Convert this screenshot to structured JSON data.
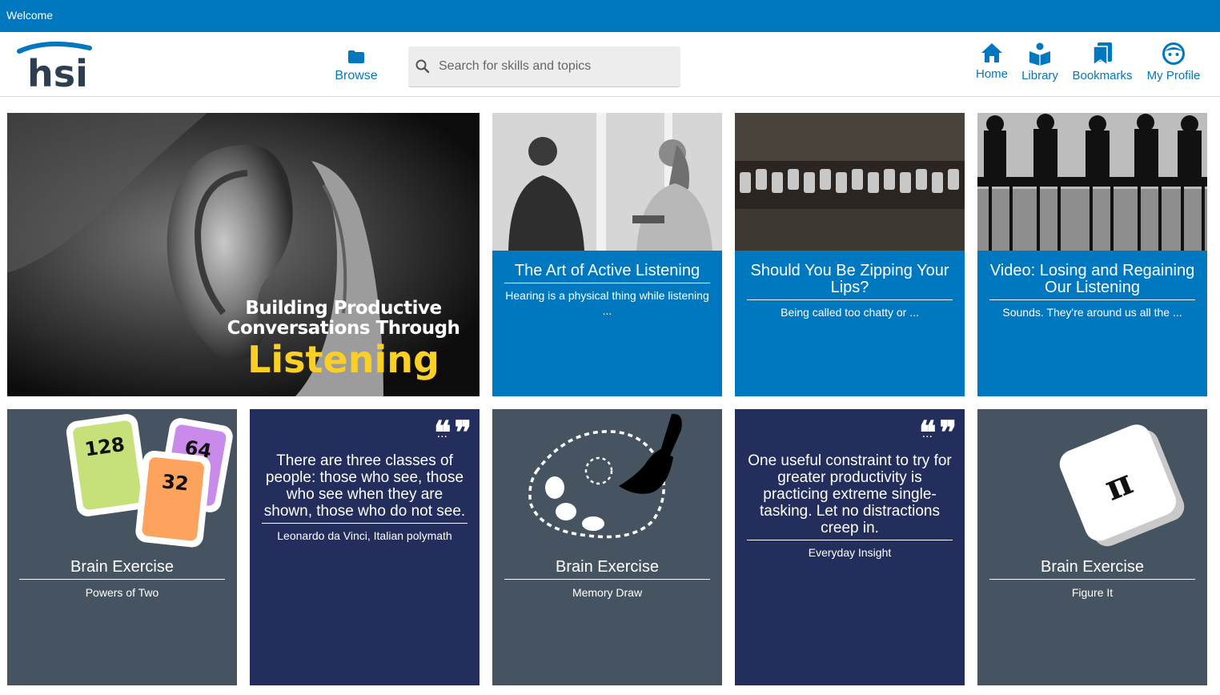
{
  "topbar": {
    "welcome": "Welcome"
  },
  "header": {
    "logo_text": "hsi",
    "browse_label": "Browse",
    "search_placeholder": "Search for skills and topics",
    "nav": [
      {
        "label": "Home",
        "icon": "home-icon"
      },
      {
        "label": "Library",
        "icon": "library-icon"
      },
      {
        "label": "Bookmarks",
        "icon": "bookmarks-icon"
      },
      {
        "label": "My Profile",
        "icon": "profile-icon"
      }
    ]
  },
  "colors": {
    "brand_blue": "#0078bf",
    "slate": "#465461",
    "navy": "#232e5c",
    "accent_yellow": "#fbd026"
  },
  "hero": {
    "line1": "Building Productive",
    "line2": "Conversations Through",
    "line3": "Listening"
  },
  "cards": [
    {
      "title": "The Art of Active Listening",
      "subtitle": "Hearing is a physical thing while listening ..."
    },
    {
      "title": "Should You Be Zipping Your Lips?",
      "subtitle": "Being called too chatty or ..."
    },
    {
      "title": "Video: Losing and Regaining Our Listening",
      "subtitle": "Sounds. They're around us all the ..."
    }
  ],
  "bottom": [
    {
      "type": "brain",
      "title": "Brain Exercise",
      "subtitle": "Powers of Two",
      "numbers": [
        "128",
        "64",
        "32"
      ]
    },
    {
      "type": "quote",
      "marks": "❝❞",
      "ellipsis": "...",
      "text": "There are three classes of people: those who see, those who see when they are shown, those who do not see.",
      "author": "Leonardo da Vinci, Italian polymath"
    },
    {
      "type": "brain",
      "title": "Brain Exercise",
      "subtitle": "Memory Draw"
    },
    {
      "type": "quote",
      "marks": "❝❞",
      "ellipsis": "...",
      "text": "One useful constraint to try for greater productivity is practicing extreme single-tasking. Let no distractions creep in.",
      "author": "Everyday Insight"
    },
    {
      "type": "brain",
      "title": "Brain Exercise",
      "subtitle": "Figure It",
      "symbol": "π"
    }
  ]
}
